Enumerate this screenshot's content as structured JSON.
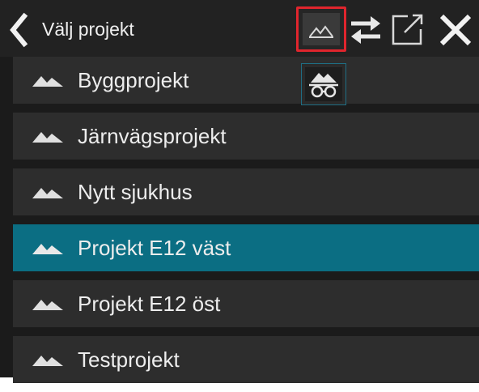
{
  "header": {
    "title": "Välj projekt",
    "back_icon": "chevron-left-icon",
    "view_toggle_icon": "mountain-icon",
    "swap_icon": "swap-arrows-icon",
    "open_icon": "open-external-icon",
    "close_icon": "close-icon"
  },
  "view_options": {
    "icon": "mountain-glasses-icon"
  },
  "projects": [
    {
      "label": "Byggprojekt",
      "icon": "mountain-icon",
      "selected": false
    },
    {
      "label": "Järnvägsprojekt",
      "icon": "mountain-icon",
      "selected": false
    },
    {
      "label": "Nytt sjukhus",
      "icon": "mountain-icon",
      "selected": false
    },
    {
      "label": "Projekt E12 väst",
      "icon": "mountain-icon",
      "selected": true
    },
    {
      "label": "Projekt E12 öst",
      "icon": "mountain-icon",
      "selected": false
    },
    {
      "label": "Testprojekt",
      "icon": "mountain-icon",
      "selected": false
    }
  ],
  "colors": {
    "background": "#1b1b1b",
    "row": "#2d2d2d",
    "selected_row": "#0b6e83",
    "highlight_border": "#e0252d",
    "text": "#ededed"
  }
}
